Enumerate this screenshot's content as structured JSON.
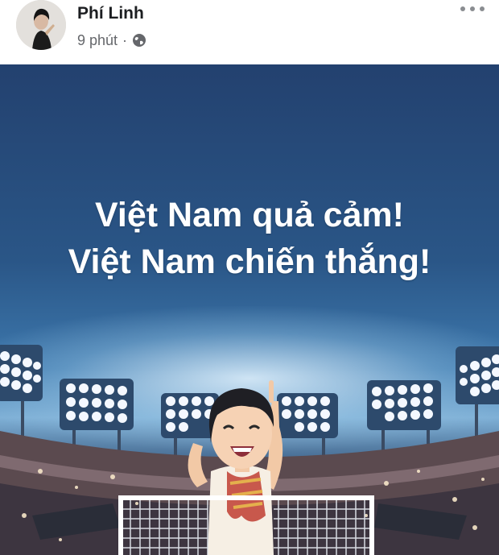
{
  "post": {
    "author_name": "Phí Linh",
    "timestamp": "9 phút",
    "separator": "·",
    "audience_icon": "globe-icon",
    "more_icon": "more-options-icon"
  },
  "banner": {
    "line1": "Việt Nam quả cảm!",
    "line2": "Việt Nam chiến thắng!",
    "background_top": "#23416f",
    "background_mid": "#3d78ad"
  }
}
